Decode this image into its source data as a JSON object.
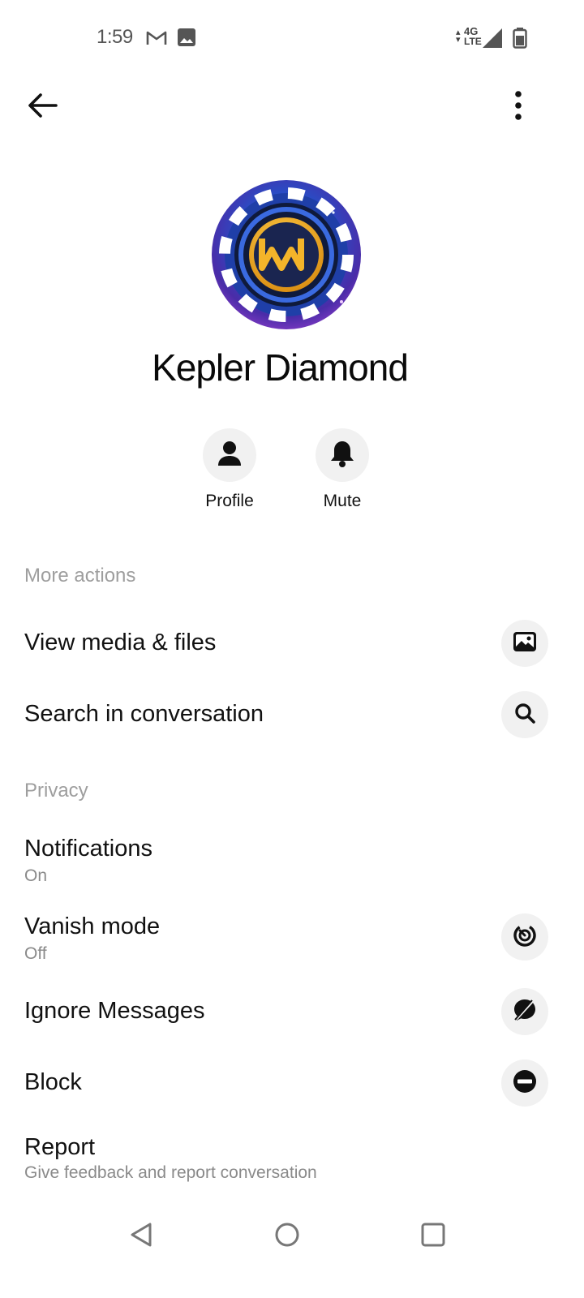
{
  "status_bar": {
    "time": "1:59",
    "network_top": "4G",
    "network_bottom": "LTE",
    "icons": [
      "gmail-icon",
      "image-icon",
      "network-arrows-icon",
      "signal-icon",
      "battery-icon"
    ]
  },
  "toolbar": {
    "back_icon": "arrow-left-icon",
    "more_icon": "more-vert-icon"
  },
  "contact": {
    "name": "Kepler Diamond",
    "avatar_letters": "MW"
  },
  "quick_actions": [
    {
      "label": "Profile",
      "icon": "person-icon"
    },
    {
      "label": "Mute",
      "icon": "bell-icon"
    }
  ],
  "more_actions": {
    "header": "More actions",
    "items": [
      {
        "title": "View media & files",
        "icon": "image-icon"
      },
      {
        "title": "Search in conversation",
        "icon": "search-icon"
      }
    ]
  },
  "privacy": {
    "header": "Privacy",
    "items": [
      {
        "title": "Notifications",
        "subtitle": "On"
      },
      {
        "title": "Vanish mode",
        "subtitle": "Off",
        "icon": "vanish-mode-icon"
      },
      {
        "title": "Ignore Messages",
        "icon": "ignore-messages-icon"
      },
      {
        "title": "Block",
        "icon": "block-icon"
      },
      {
        "title": "Report",
        "subtitle": "Give feedback and report conversation"
      }
    ]
  },
  "nav_bar": {
    "icons": [
      "back-triangle-icon",
      "home-circle-icon",
      "recents-square-icon"
    ]
  },
  "colors": {
    "background": "#ffffff",
    "text_primary": "#111111",
    "text_secondary": "#8a8a8a",
    "section_header": "#9e9e9e",
    "icon_circle_bg": "#f1f1f1"
  }
}
